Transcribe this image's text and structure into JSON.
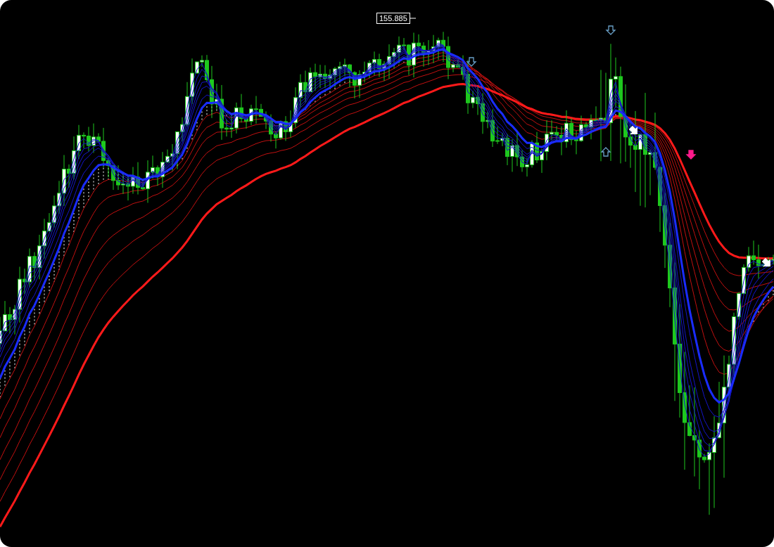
{
  "chart": {
    "price_label": "155.885"
  }
}
